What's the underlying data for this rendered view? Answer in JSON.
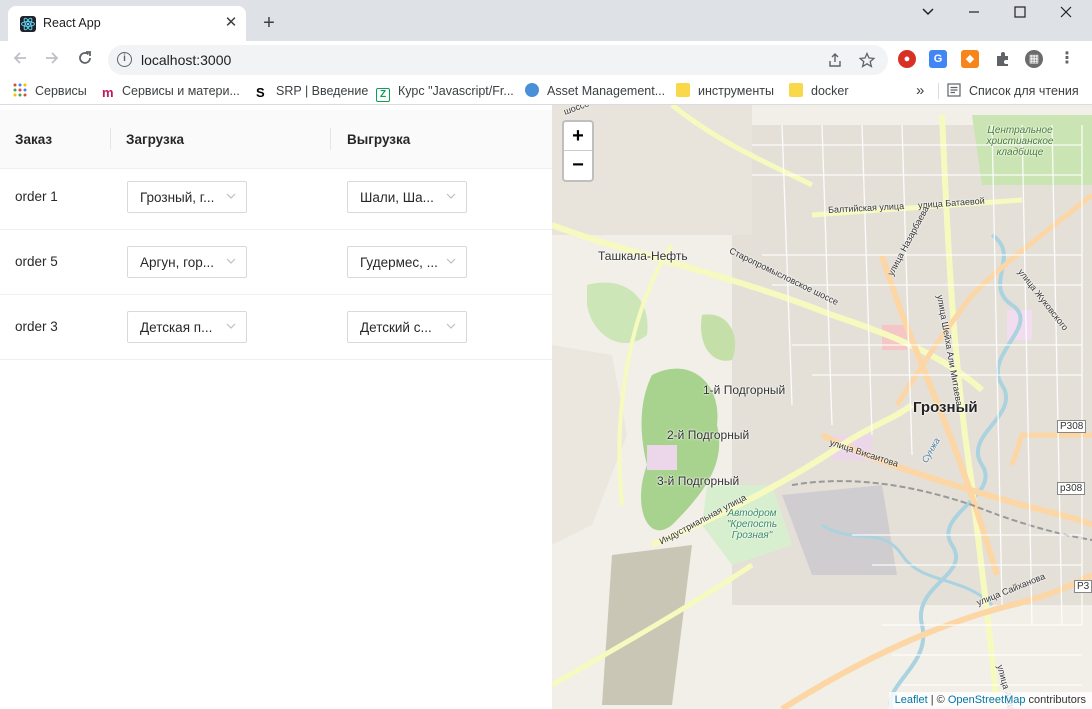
{
  "browser": {
    "tab_title": "React App",
    "new_tab": "+",
    "url": "localhost:3000",
    "controls": {
      "minimize": "—",
      "maximize": "☐",
      "close": "✕",
      "tab_menu": "⌄"
    }
  },
  "bookmarks": [
    {
      "label": "Сервисы",
      "icon": "apps-grid-icon"
    },
    {
      "label": "Сервисы и матери...",
      "icon": "m-logo-icon"
    },
    {
      "label": "SRP | Введение",
      "icon": "s-logo-icon"
    },
    {
      "label": "Курс \"Javascript/Fr...",
      "icon": "z-logo-icon"
    },
    {
      "label": "Asset Management...",
      "icon": "asset-logo-icon"
    },
    {
      "label": "инструменты",
      "icon": "folder-icon"
    },
    {
      "label": "docker",
      "icon": "folder-icon"
    }
  ],
  "bookmarks_more": "»",
  "reading_list": "Список для чтения",
  "table": {
    "columns": [
      "Заказ",
      "Загрузка",
      "Выгрузка"
    ],
    "rows": [
      {
        "order": "order 1",
        "load": "Грозный, г...",
        "unload": "Шали, Ша..."
      },
      {
        "order": "order 5",
        "load": "Аргун, гор...",
        "unload": "Гудермес, ..."
      },
      {
        "order": "order 3",
        "load": "Детская п...",
        "unload": "Детский с..."
      }
    ]
  },
  "map": {
    "zoom_in": "+",
    "zoom_out": "−",
    "labels": {
      "grozny": "Грозный",
      "tashkala": "Ташкала-Нефть",
      "podgorny1": "1-й Подгорный",
      "podgorny2": "2-й Подгорный",
      "podgorny3": "3-й Подгорный",
      "cemetery": "Центральное христианское кладбище",
      "avtodrom": "Автодром \"Крепость Грозная\"",
      "baltiyskaya": "Балтийская улица",
      "bataeva": "улица Батаевой",
      "staropromyslovskoe": "Старопромысловское шоссе",
      "nazarbaeva": "улица Назарбаева",
      "sheikha": "улица Шейха Али Митаева",
      "zhukovskogo": "улица Жуковского",
      "visaitova": "улица Висаитова",
      "industrialnaya": "Индустриальная улица",
      "saikhanova": "улица Сайханова",
      "sunzha": "Сунжа",
      "r308a": "Р308",
      "r308b": "р308",
      "r3": "Р3",
      "abdaly": "улица Абдалы II",
      "shosse_edge": "шоссе"
    },
    "attribution": {
      "leaflet": "Leaflet",
      "sep": " | © ",
      "osm": "OpenStreetMap",
      "suffix": " contributors"
    }
  },
  "colors": {
    "tabstrip": "#dee1e6",
    "map_bg": "#f2efe9",
    "park": "#a8d38f",
    "water": "#aad3df",
    "primary_road": "#fcd6a4",
    "secondary_road": "#f7fabf",
    "link": "#0078a8"
  }
}
